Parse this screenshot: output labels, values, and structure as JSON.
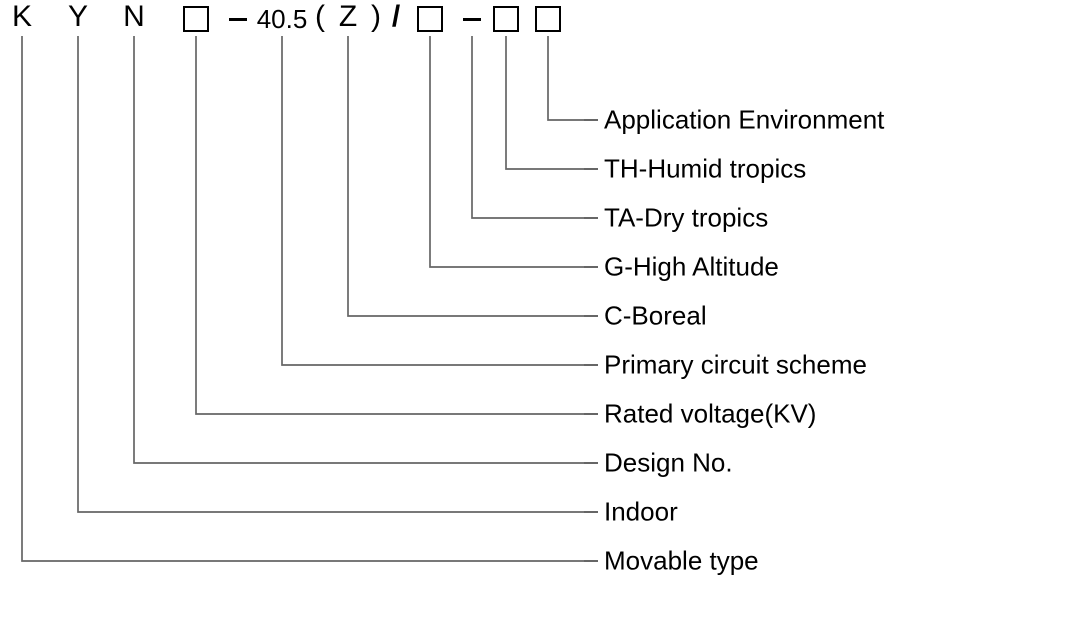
{
  "code": {
    "seg1": "K",
    "seg2": "Y",
    "seg3": "N",
    "seg4_box": true,
    "seg5_dash": true,
    "seg6": "40.5",
    "seg7_lparen": "(",
    "seg8": "Z",
    "seg9_rparen": ")",
    "seg10_slash": "/",
    "seg11_box": true,
    "seg12_dash": true,
    "seg13_box": true,
    "seg14_box": true
  },
  "labels": {
    "l1": "Application Environment",
    "l2": "TH-Humid tropics",
    "l3": "TA-Dry tropics",
    "l4": "G-High Altitude",
    "l5": "C-Boreal",
    "l6": "Primary circuit scheme",
    "l7": "Rated voltage(KV)",
    "l8": "Design No.",
    "l9": "Indoor",
    "l10": "Movable type"
  }
}
